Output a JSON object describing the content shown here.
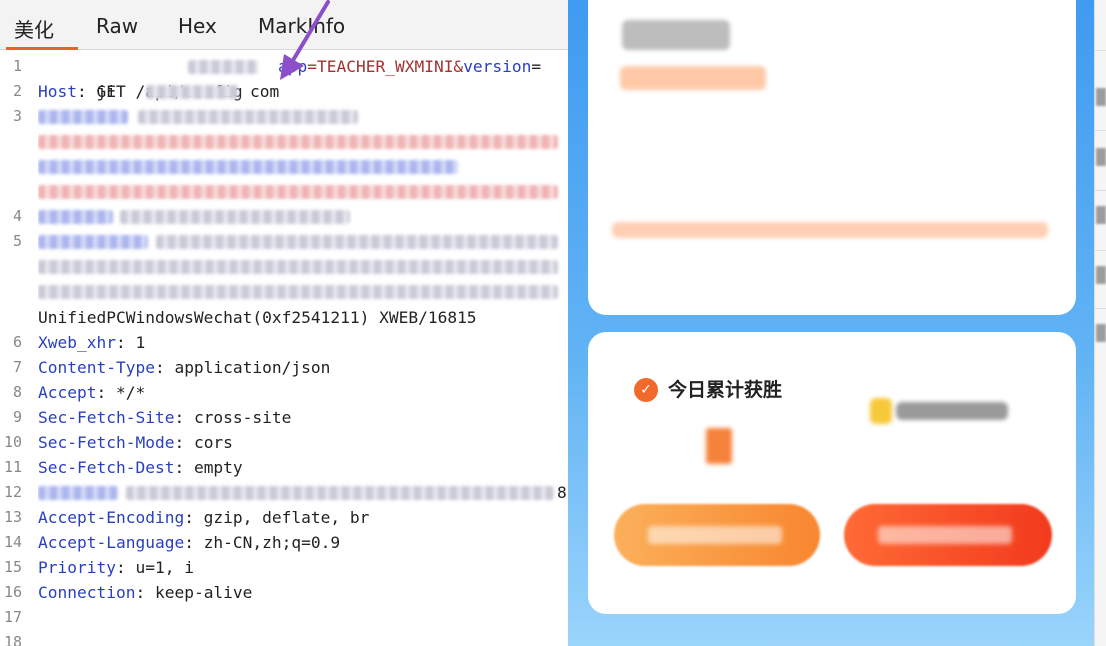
{
  "editor": {
    "tabs": [
      {
        "label": "美化",
        "active": true
      },
      {
        "label": "Raw",
        "active": false
      },
      {
        "label": "Hex",
        "active": false
      },
      {
        "label": "MarkInfo",
        "active": false
      }
    ],
    "line_numbers": [
      "1",
      "2",
      "3",
      "4",
      "5",
      "6",
      "7",
      "8",
      "9",
      "10",
      "11",
      "12",
      "13",
      "14",
      "15",
      "16",
      "17",
      "18"
    ],
    "request": {
      "line1_method_path": "GET /api/config",
      "line1_app_key": "app",
      "line1_app_value": "=TEACHER_WXMINI&",
      "line1_version_key": "version",
      "line1_eq": "=",
      "line2_key": "Host",
      "line2_value_a": ": ji",
      "line2_value_b": "com",
      "line5_tail": "UnifiedPCWindowsWechat(0xf2541211) XWEB/16815",
      "headers": [
        {
          "key": "Xweb_xhr",
          "value": ": 1"
        },
        {
          "key": "Content-Type",
          "value": ": application/json"
        },
        {
          "key": "Accept",
          "value": ": */*"
        },
        {
          "key": "Sec-Fetch-Site",
          "value": ": cross-site"
        },
        {
          "key": "Sec-Fetch-Mode",
          "value": ": cors"
        },
        {
          "key": "Sec-Fetch-Dest",
          "value": ": empty"
        }
      ],
      "line12_tail": "8",
      "headers2": [
        {
          "key": "Accept-Encoding",
          "value": ": gzip, deflate, br"
        },
        {
          "key": "Accept-Language",
          "value": ": zh-CN,zh;q=0.9"
        },
        {
          "key": "Priority",
          "value": ": u=1, i"
        },
        {
          "key": "Connection",
          "value": ": keep-alive"
        }
      ]
    }
  },
  "miniprogram": {
    "wins_title": "今日累计获胜",
    "check_icon": "check-circle-icon"
  },
  "colors": {
    "header_key": "#2a3fbf",
    "active_tab_underline": "#e8622c",
    "arrow": "#8a4fc9",
    "button_orange": "#f8862f",
    "button_red": "#f23a1d"
  }
}
